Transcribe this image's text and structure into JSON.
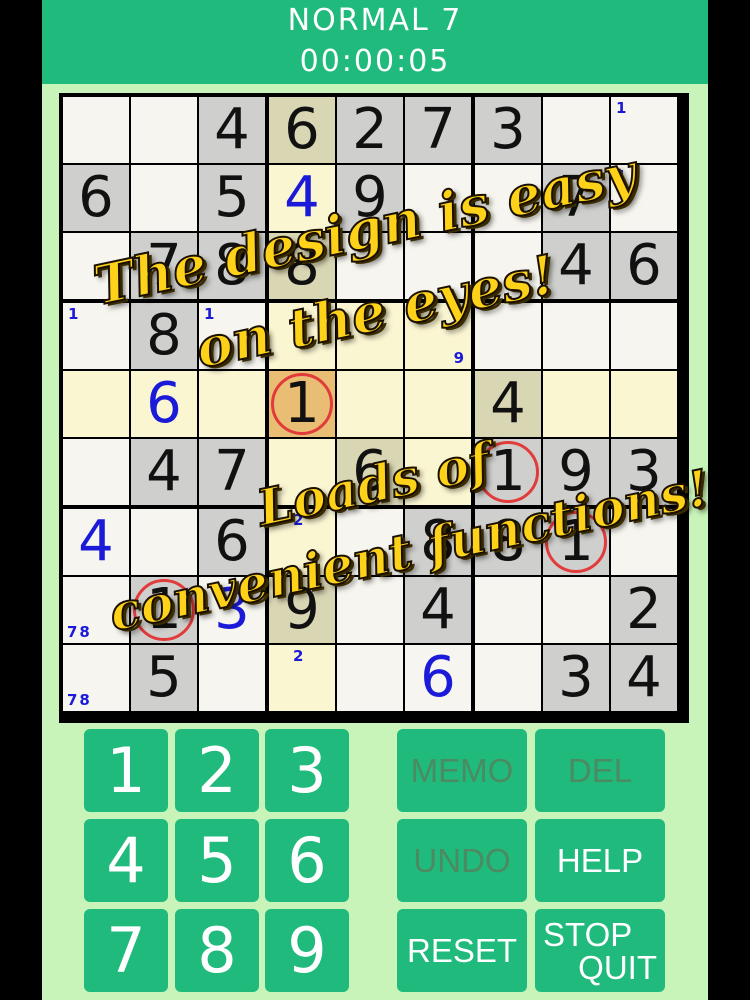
{
  "header": {
    "level": "NORMAL 7",
    "timer": "00:00:05"
  },
  "board": {
    "given_grid": [
      [
        0,
        0,
        4,
        6,
        2,
        7,
        3,
        0,
        0
      ],
      [
        6,
        0,
        5,
        0,
        9,
        0,
        0,
        7,
        0
      ],
      [
        0,
        7,
        8,
        8,
        0,
        0,
        0,
        4,
        6
      ],
      [
        0,
        8,
        0,
        0,
        0,
        0,
        0,
        0,
        0
      ],
      [
        0,
        0,
        0,
        1,
        0,
        0,
        4,
        0,
        0
      ],
      [
        0,
        4,
        7,
        0,
        6,
        0,
        1,
        9,
        3
      ],
      [
        0,
        0,
        6,
        0,
        0,
        8,
        8,
        1,
        0
      ],
      [
        0,
        1,
        0,
        9,
        0,
        4,
        0,
        0,
        2
      ],
      [
        0,
        5,
        0,
        0,
        0,
        0,
        0,
        3,
        4
      ]
    ],
    "entered_cells": [
      {
        "r": 1,
        "c": 3,
        "value": "4"
      },
      {
        "r": 4,
        "c": 1,
        "value": "6"
      },
      {
        "r": 6,
        "c": 0,
        "value": "4"
      },
      {
        "r": 7,
        "c": 2,
        "value": "3"
      },
      {
        "r": 8,
        "c": 5,
        "value": "6"
      }
    ],
    "memo_cells": [
      {
        "r": 0,
        "c": 8,
        "text": "1",
        "pos": "tl"
      },
      {
        "r": 1,
        "c": 8,
        "text": "1",
        "pos": "tl"
      },
      {
        "r": 3,
        "c": 0,
        "text": "1",
        "pos": "tl"
      },
      {
        "r": 3,
        "c": 2,
        "text": "1",
        "pos": "tl"
      },
      {
        "r": 3,
        "c": 5,
        "text": "9",
        "pos": "br"
      },
      {
        "r": 6,
        "c": 3,
        "text": "2",
        "pos": "tc"
      },
      {
        "r": 7,
        "c": 0,
        "text": "78",
        "pos": "bl"
      },
      {
        "r": 8,
        "c": 0,
        "text": "78",
        "pos": "bl"
      },
      {
        "r": 8,
        "c": 3,
        "text": "2",
        "pos": "tc"
      }
    ],
    "circled_cells": [
      {
        "r": 4,
        "c": 3
      },
      {
        "r": 5,
        "c": 6
      },
      {
        "r": 6,
        "c": 7
      },
      {
        "r": 7,
        "c": 1
      }
    ],
    "selected_cell": {
      "r": 4,
      "c": 3
    },
    "colors": {
      "blank": "#f6f5ef",
      "given_bg": "#cfcfcd",
      "highlight": "#fbf6d2",
      "highlight_given": "#d9d6b4",
      "selected": "#e9bd73",
      "given_text": "#111111",
      "entered_text": "#1a1ad8",
      "memo_text": "#1a1ad8",
      "ring": "#e23b3b"
    }
  },
  "keypad": {
    "digits": [
      "1",
      "2",
      "3",
      "4",
      "5",
      "6",
      "7",
      "8",
      "9"
    ]
  },
  "functions": {
    "memo": "MEMO",
    "del": "DEL",
    "undo": "UNDO",
    "help": "HELP",
    "reset": "RESET",
    "stop": "STOP",
    "quit": "QUIT"
  },
  "promo": {
    "line1": "The design is easy",
    "line2": "on the eyes!",
    "line3": "Loads of",
    "line4": "convenient functions!"
  }
}
